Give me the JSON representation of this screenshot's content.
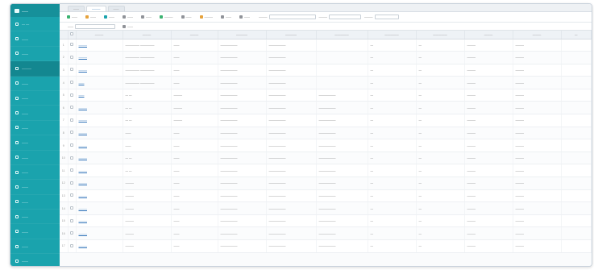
{
  "sidebar": {
    "logo": "——",
    "items": [
      {
        "label": "— —"
      },
      {
        "label": "——"
      },
      {
        "label": "——"
      },
      {
        "label": "———"
      },
      {
        "label": "——"
      },
      {
        "label": "——"
      },
      {
        "label": "——"
      },
      {
        "label": "——"
      },
      {
        "label": "——"
      },
      {
        "label": "——"
      },
      {
        "label": "——"
      },
      {
        "label": "——"
      },
      {
        "label": "——"
      },
      {
        "label": "——"
      },
      {
        "label": "——"
      },
      {
        "label": "——"
      },
      {
        "label": "——"
      }
    ]
  },
  "tabs": [
    {
      "label": "——"
    },
    {
      "label": "———"
    },
    {
      "label": "——"
    }
  ],
  "toolbar": {
    "buttons": [
      {
        "label": "——",
        "color": "#3cb371"
      },
      {
        "label": "——",
        "color": "#e6a23c"
      },
      {
        "label": "——",
        "color": "#1aa3ad"
      },
      {
        "label": "——",
        "color": "#909399"
      },
      {
        "label": "——",
        "color": "#909399"
      },
      {
        "label": "———",
        "color": "#3cb371"
      },
      {
        "label": "——",
        "color": "#909399"
      },
      {
        "label": "———",
        "color": "#e6a23c"
      },
      {
        "label": "——",
        "color": "#909399"
      },
      {
        "label": "——",
        "color": "#909399"
      }
    ],
    "filters": [
      {
        "label": "———"
      },
      {
        "label": "———"
      },
      {
        "label": "———"
      }
    ],
    "second_row": {
      "label": "——",
      "button": "——"
    }
  },
  "table": {
    "columns": [
      "",
      "",
      "———",
      "———",
      "———",
      "————",
      "————",
      "—————",
      "—————",
      "—————",
      "———",
      "———",
      "—"
    ],
    "rows": [
      [
        "1",
        "———",
        "————— —————",
        "——",
        "——————",
        "——————",
        "",
        "—",
        "—",
        "———",
        "———"
      ],
      [
        "2",
        "———",
        "————— —————",
        "——",
        "——————",
        "——————",
        "",
        "—",
        "—",
        "———",
        "———"
      ],
      [
        "3",
        "———",
        "————— —————",
        "——",
        "——————",
        "——————",
        "",
        "—",
        "—",
        "———",
        "———"
      ],
      [
        "4",
        "——",
        "————— —————",
        "——",
        "——————",
        "——————",
        "",
        "—",
        "—",
        "———",
        "———"
      ],
      [
        "5",
        "——",
        "— —",
        "———",
        "——————",
        "——————",
        "——————",
        "—",
        "—",
        "———",
        "———"
      ],
      [
        "6",
        "———",
        "— —",
        "———",
        "——————",
        "——————",
        "——————",
        "—",
        "—",
        "———",
        "———"
      ],
      [
        "7",
        "———",
        "— —",
        "———",
        "——————",
        "——————",
        "——————",
        "—",
        "—",
        "———",
        "———"
      ],
      [
        "8",
        "———",
        "——",
        "——",
        "——————",
        "——————",
        "——————",
        "—",
        "—",
        "———",
        "———"
      ],
      [
        "9",
        "———",
        "——",
        "——",
        "——————",
        "——————",
        "——————",
        "—",
        "—",
        "———",
        "———"
      ],
      [
        "10",
        "———",
        "— —",
        "——",
        "——————",
        "——————",
        "——————",
        "—",
        "—",
        "———",
        "———"
      ],
      [
        "11",
        "———",
        "— —",
        "——",
        "——————",
        "——————",
        "——————",
        "—",
        "—",
        "———",
        "———"
      ],
      [
        "12",
        "———",
        "———",
        "——",
        "——————",
        "——————",
        "——————",
        "—",
        "—",
        "———",
        "———"
      ],
      [
        "13",
        "———",
        "———",
        "——",
        "——————",
        "——————",
        "——————",
        "—",
        "—",
        "———",
        "———"
      ],
      [
        "14",
        "———",
        "———",
        "——",
        "——————",
        "——————",
        "——————",
        "—",
        "—",
        "———",
        "———"
      ],
      [
        "15",
        "———",
        "———",
        "——",
        "——————",
        "——————",
        "——————",
        "—",
        "—",
        "———",
        "———"
      ],
      [
        "16",
        "———",
        "———",
        "——",
        "——————",
        "——————",
        "——————",
        "—",
        "—",
        "———",
        "———"
      ],
      [
        "17",
        "———",
        "———",
        "——",
        "——————",
        "——————",
        "——————",
        "—",
        "—",
        "———",
        "———"
      ]
    ]
  }
}
